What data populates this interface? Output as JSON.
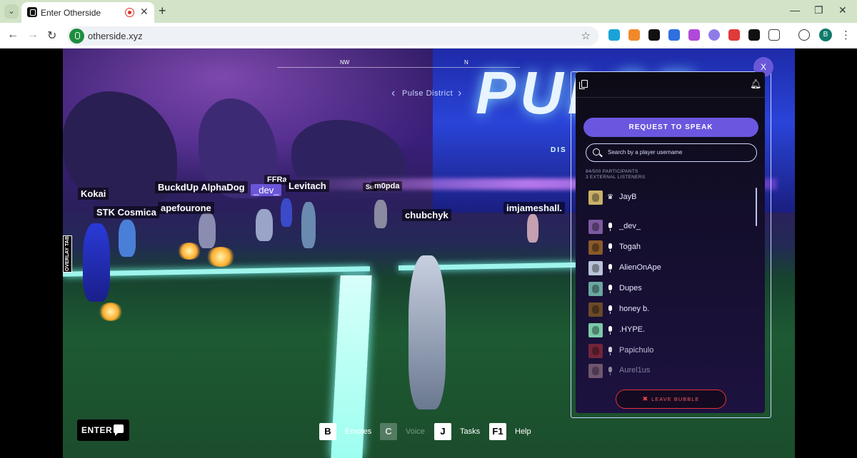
{
  "browser": {
    "tab_title": "Enter Otherside",
    "url": "otherside.xyz",
    "profile_initial": "B"
  },
  "hud": {
    "district": "Pulse District",
    "compass": [
      "NW",
      "N"
    ],
    "billboard_text": "PULSE",
    "billboard_sub": "DIS",
    "overlay_tab": "OVERLAY TAB",
    "enter_label": "ENTER",
    "hotkeys": [
      {
        "key": "B",
        "label": "Emotes",
        "enabled": true
      },
      {
        "key": "C",
        "label": "Voice",
        "enabled": false
      },
      {
        "key": "J",
        "label": "Tasks",
        "enabled": true
      },
      {
        "key": "F1",
        "label": "Help",
        "enabled": true
      }
    ]
  },
  "nametags": [
    {
      "name": "Kokai"
    },
    {
      "name": "STK Cosmica"
    },
    {
      "name": "BuckdUp AlphaDog"
    },
    {
      "name": "apefourone"
    },
    {
      "name": "FFRa"
    },
    {
      "name": "_dev_"
    },
    {
      "name": "Levitach"
    },
    {
      "name": "Su"
    },
    {
      "name": "m0pda"
    },
    {
      "name": "chubchyk"
    },
    {
      "name": "imjameshall."
    }
  ],
  "voice_panel": {
    "close_label": "X",
    "request_label": "REQUEST TO SPEAK",
    "search_placeholder": "Search by a player username",
    "participants_count": "84/500 PARTICIPANTS",
    "listeners_count": "3 EXTERNAL LISTENERS",
    "leave_label": "LEAVE BUBBLE",
    "participants": [
      {
        "name": "JayB",
        "role": "host",
        "color": "#c9b06a"
      },
      {
        "name": "_dev_",
        "role": "speaker",
        "color": "#7b5aa0"
      },
      {
        "name": "Togah",
        "role": "speaker",
        "color": "#8a5a2a"
      },
      {
        "name": "AlienOnApe",
        "role": "speaker",
        "color": "#b8c4d8"
      },
      {
        "name": "Dupes",
        "role": "speaker",
        "color": "#6aa8a0"
      },
      {
        "name": "honey b.",
        "role": "speaker",
        "color": "#6b4a2a"
      },
      {
        "name": ".HYPE.",
        "role": "speaker",
        "color": "#7acaa8"
      },
      {
        "name": "Papichulo",
        "role": "speaker",
        "color": "#8a2a3a"
      },
      {
        "name": "Aurel1us",
        "role": "speaker",
        "color": "#c49aa0"
      }
    ]
  }
}
